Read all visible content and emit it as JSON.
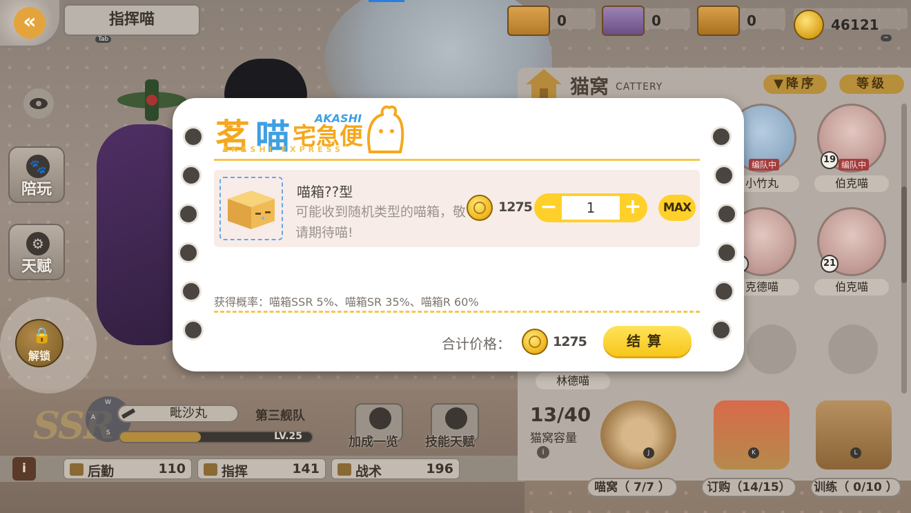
{
  "header": {
    "title": "指挥喵",
    "tab_hint": "Tab",
    "tilde_hint": "~"
  },
  "resources": {
    "box_ssr": "0",
    "box_sr": "0",
    "box_r": "0",
    "coins": "46121"
  },
  "side": {
    "play_label": "陪玩",
    "talent_label": "天赋",
    "unlock_label": "解锁"
  },
  "commander": {
    "rarity": "SSR",
    "compass": {
      "n": "W",
      "e": "D",
      "s": "S",
      "w": "A"
    },
    "name": "毗沙丸",
    "fleet": "第三舰队",
    "level": "LV.25",
    "exp_fraction": 0.42,
    "bonus_label": "加成一览",
    "skill_label": "技能天赋"
  },
  "stats": {
    "info": "i",
    "logistics_label": "后勤",
    "logistics_value": "110",
    "command_label": "指挥",
    "command_value": "141",
    "tactics_label": "战术",
    "tactics_value": "196"
  },
  "cattery": {
    "title": "猫窝",
    "subtitle": "CATTERY",
    "sort_desc": "▼降序",
    "sort_level": "等级",
    "cats": [
      {
        "name": "小竹丸",
        "level": "",
        "tag": "编队中"
      },
      {
        "name": "伯克喵",
        "level": "19",
        "tag": "编队中"
      },
      {
        "name": "克德喵",
        "level": "2",
        "tag": ""
      },
      {
        "name": "伯克喵",
        "level": "21",
        "tag": ""
      },
      {
        "name": "林德喵",
        "level": "",
        "tag": ""
      }
    ],
    "capacity_value": "13/40",
    "capacity_label": "猫窝容量",
    "capacity_info": "i",
    "facilities": [
      {
        "label": "喵窝（ 7/7 ）",
        "key": "J"
      },
      {
        "label": "订购（14/15）",
        "key": "K"
      },
      {
        "label": "训练（ 0/10 ）",
        "key": "L"
      }
    ]
  },
  "shop": {
    "logo_main_1": "茗",
    "logo_main_2": "喵",
    "logo_main_3": "宅急便",
    "logo_akashi": "AKASHI",
    "logo_express": "AKASHI EXPRESS",
    "item_name": "喵箱??型",
    "item_desc": "可能收到随机类型的喵箱，敬请期待喵!",
    "unit_price": "1275",
    "quantity": "1",
    "minus": "−",
    "plus": "+",
    "max_label": "MAX",
    "probability": "获得概率：喵箱SSR 5%、喵箱SR 35%、喵箱R 60%",
    "total_label": "合计价格：",
    "total_price": "1275",
    "checkout_label": "结算"
  },
  "colors": {
    "accent_yellow": "#ffd02a",
    "accent_blue": "#3f9fe3",
    "orange": "#f6a71c"
  }
}
